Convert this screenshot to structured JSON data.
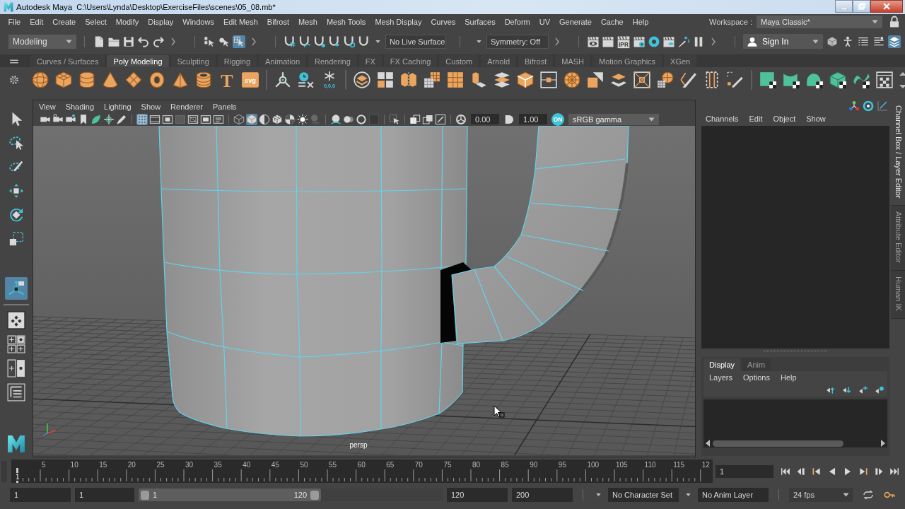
{
  "window": {
    "app": "Autodesk Maya",
    "file": "C:\\Users\\Lynda\\Desktop\\ExerciseFiles\\scenes\\05_08.mb*"
  },
  "menu_bar": {
    "items": [
      "File",
      "Edit",
      "Create",
      "Select",
      "Modify",
      "Display",
      "Windows",
      "Edit Mesh",
      "Bifrost",
      "Mesh",
      "Mesh Tools",
      "Mesh Display",
      "Curves",
      "Surfaces",
      "Deform",
      "UV",
      "Generate",
      "Cache",
      "Help"
    ],
    "workspace_label": "Workspace :",
    "workspace": "Maya Classic*"
  },
  "status_line": {
    "menu_set": "Modeling",
    "selection_modes": [
      {
        "selected": false
      },
      {
        "selected": false
      },
      {
        "selected": true
      }
    ],
    "live_surface": "No Live Surface",
    "symmetry": "Symmetry: Off",
    "ipr_label": "IPR",
    "sign_in": "Sign In",
    "panel_toggles": [
      {
        "selected": false
      },
      {
        "selected": false
      },
      {
        "selected": false
      },
      {
        "selected": false
      },
      {
        "selected": true
      }
    ]
  },
  "shelf": {
    "tabs": [
      {
        "label": "Curves / Surfaces",
        "selected": false
      },
      {
        "label": "Poly Modeling",
        "selected": true
      },
      {
        "label": "Sculpting",
        "selected": false
      },
      {
        "label": "Rigging",
        "selected": false
      },
      {
        "label": "Animation",
        "selected": false
      },
      {
        "label": "Rendering",
        "selected": false
      },
      {
        "label": "FX",
        "selected": false
      },
      {
        "label": "FX Caching",
        "selected": false
      },
      {
        "label": "Custom",
        "selected": false
      },
      {
        "label": "Arnold",
        "selected": false
      },
      {
        "label": "Bifrost",
        "selected": false
      },
      {
        "label": "MASH",
        "selected": false
      },
      {
        "label": "Motion Graphics",
        "selected": false
      },
      {
        "label": "XGen",
        "selected": false
      }
    ],
    "type_letter": "T",
    "svg_label": "svg",
    "freeze_label": "0,0,0"
  },
  "toolbox": {
    "tools": [
      {
        "selected": false
      },
      {
        "selected": false
      },
      {
        "selected": false
      },
      {
        "selected": false
      },
      {
        "selected": false
      },
      {
        "selected": false
      },
      {
        "selected": true
      }
    ]
  },
  "viewport": {
    "menus": [
      "View",
      "Shading",
      "Lighting",
      "Show",
      "Renderer",
      "Panels"
    ],
    "toolbar_toggles": [
      {
        "selected": false
      },
      {
        "selected": false
      },
      {
        "selected": false
      },
      {
        "selected": false
      },
      {
        "selected": false
      },
      {
        "selected": false
      },
      {
        "selected": false
      },
      {
        "selected": true
      },
      {
        "selected": false
      },
      {
        "selected": false
      },
      {
        "selected": false
      },
      {
        "selected": false
      },
      {
        "selected": false
      },
      {
        "selected": false
      },
      {
        "selected": false
      },
      {
        "selected": true
      },
      {
        "selected": false
      },
      {
        "selected": false
      },
      {
        "selected": false
      },
      {
        "selected": false
      },
      {
        "selected": false
      },
      {
        "selected": false
      },
      {
        "selected": false
      },
      {
        "selected": false
      },
      {
        "selected": false
      },
      {
        "selected": false
      },
      {
        "selected": false
      },
      {
        "selected": false
      },
      {
        "selected": false
      }
    ],
    "exposure": "0.00",
    "gamma": "1.00",
    "color_management": {
      "label": "ON",
      "on": true
    },
    "view_transform": "sRGB gamma",
    "camera": "persp"
  },
  "channel_box": {
    "menus": [
      "Channels",
      "Edit",
      "Object",
      "Show"
    ]
  },
  "layer_editor": {
    "tabs": [
      {
        "label": "Display",
        "selected": true
      },
      {
        "label": "Anim",
        "selected": false
      }
    ],
    "menus": [
      "Layers",
      "Options",
      "Help"
    ]
  },
  "side_tabs": [
    {
      "label": "Channel Box / Layer Editor",
      "selected": true
    },
    {
      "label": "Attribute Editor",
      "selected": false
    },
    {
      "label": "Human IK",
      "selected": false
    }
  ],
  "time_slider": {
    "current_frame": "1",
    "tick_labels": [
      "5",
      "10",
      "15",
      "20",
      "25",
      "30",
      "35",
      "40",
      "45",
      "50",
      "55",
      "60",
      "65",
      "70",
      "75",
      "80",
      "85",
      "90",
      "95",
      "100",
      "105",
      "110",
      "115",
      "12"
    ],
    "frame_field": "1"
  },
  "range_slider": {
    "start": "1",
    "playback_start": "1",
    "bar_start": "1",
    "bar_end": "120",
    "level": 0.6,
    "playback_end": "120",
    "end": "200",
    "character_set": "No Character Set",
    "anim_layer": "No Anim Layer",
    "fps": "24 fps"
  }
}
